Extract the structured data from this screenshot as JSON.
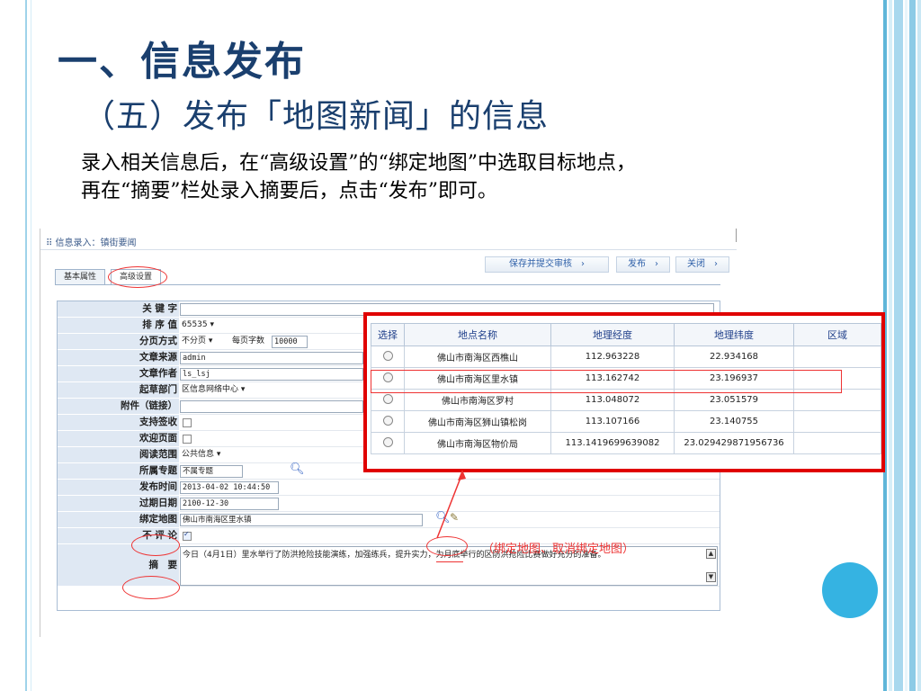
{
  "slide": {
    "title": "一、信息发布",
    "subtitle": "（五）发布「地图新闻」的信息",
    "instruction_line1": "录入相关信息后，在“高级设置”的“绑定地图”中选取目标地点，",
    "instruction_line2": "再在“摘要”栏处录入摘要后，点击“发布”即可。",
    "annotation": "（绑定地图、取消绑定地图）"
  },
  "app": {
    "breadcrumb": "信息录入：镇街要闻",
    "tabs": {
      "basic": "基本属性",
      "advanced": "高级设置"
    },
    "toolbar": {
      "save_submit": "保存并提交审核",
      "publish": "发布",
      "close": "关闭",
      "arrow": "›"
    },
    "form": {
      "keyword": {
        "label": "关 键 字",
        "value": ""
      },
      "sort": {
        "label": "排 序 值",
        "value": "65535 ▾"
      },
      "paging": {
        "label": "分页方式",
        "value": "不分页 ▾",
        "chars_label": "每页字数",
        "chars_value": "10000"
      },
      "source": {
        "label": "文章来源",
        "value": "admin"
      },
      "author": {
        "label": "文章作者",
        "value": "ls_lsj"
      },
      "dept": {
        "label": "起草部门",
        "value": "区信息网络中心   ▾"
      },
      "attachment": {
        "label": "附件（链接）",
        "value": ""
      },
      "sign": {
        "label": "支持签收"
      },
      "welcome": {
        "label": "欢迎页面"
      },
      "scope": {
        "label": "阅读范围",
        "value": "公共信息 ▾"
      },
      "topic": {
        "label": "所属专题",
        "value": "不属专题"
      },
      "pubtime": {
        "label": "发布时间",
        "value": "2013-04-02 10:44:50"
      },
      "expire": {
        "label": "过期日期",
        "value": "2100-12-30"
      },
      "map": {
        "label": "绑定地图",
        "value": "佛山市南海区里水镇"
      },
      "nocomment": {
        "label": "不 评 论"
      },
      "summary": {
        "label": "摘　要",
        "value": "今日（4月1日）里水举行了防洪抢险技能演练，加强练兵，提升实力，为月底举行的区防洪抢险比赛做好充分的准备。"
      }
    },
    "map_picker": {
      "headers": [
        "选择",
        "地点名称",
        "地理经度",
        "地理纬度",
        "区域"
      ],
      "rows": [
        {
          "name": "佛山市南海区西樵山",
          "lng": "112.963228",
          "lat": "22.934168"
        },
        {
          "name": "佛山市南海区里水镇",
          "lng": "113.162742",
          "lat": "23.196937"
        },
        {
          "name": "佛山市南海区罗村",
          "lng": "113.048072",
          "lat": "23.051579"
        },
        {
          "name": "佛山市南海区狮山镇松岗",
          "lng": "113.107166",
          "lat": "23.140755"
        },
        {
          "name": "佛山市南海区物价局",
          "lng": "113.1419699639082",
          "lat": "23.029429871956736"
        }
      ]
    }
  }
}
